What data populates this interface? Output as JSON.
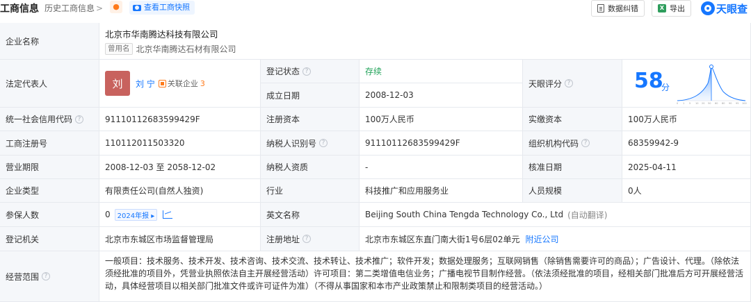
{
  "header": {
    "title": "工商信息",
    "history_link": "历史工商信息",
    "history_chevron": ">",
    "snapshot_button": "查看工商快照",
    "correction_button": "数据纠错",
    "export_button": "导出",
    "logo_text": "天眼查",
    "brand_color": "#1677ff"
  },
  "labels": {
    "company_name": "企业名称",
    "legal_rep": "法定代表人",
    "reg_status": "登记状态",
    "established": "成立日期",
    "tianyan_score": "天眼评分",
    "credit_code": "统一社会信用代码",
    "registered_capital": "注册资本",
    "paid_capital": "实缴资本",
    "business_reg_no": "工商注册号",
    "taxpayer_id": "纳税人识别号",
    "org_code": "组织机构代码",
    "business_term": "营业期限",
    "taxpayer_qualification": "纳税人资质",
    "approval_date": "核准日期",
    "company_type": "企业类型",
    "industry": "行业",
    "staff_size": "人员规模",
    "insured_count": "参保人数",
    "english_name": "英文名称",
    "registration_authority": "登记机关",
    "registered_address": "注册地址",
    "business_scope": "经营范围"
  },
  "company": {
    "name": "北京市华南腾达科技有限公司",
    "former_name_tag": "曾用名",
    "former_name": "北京华南腾达石材有限公司",
    "legal_rep_avatar": "刘",
    "legal_rep_name": "刘 宁",
    "related_label": "关联企业",
    "related_count": "3",
    "reg_status": "存续",
    "established": "2008-12-03",
    "score_value": "58",
    "score_unit": "分",
    "credit_code": "91110112683599429F",
    "registered_capital": "100万人民币",
    "paid_capital": "100万人民币",
    "business_reg_no": "110112011503320",
    "taxpayer_id": "91110112683599429F",
    "org_code": "68359942-9",
    "business_term": "2008-12-03 至 2058-12-02",
    "taxpayer_qualification": "-",
    "approval_date": "2025-04-11",
    "company_type": "有限责任公司(自然人独资)",
    "industry": "科技推广和应用服务业",
    "staff_size": "0人",
    "insured_count": "0",
    "report_tag": "2024年报",
    "english_name": "Beijing South China Tengda Technology Co., Ltd",
    "auto_translate": "(自动翻译)",
    "registration_authority": "北京市东城区市场监督管理局",
    "registered_address": "北京市东城区东直门南大街1号6层02单元",
    "nearby_link": "附近公司",
    "business_scope": "一般项目：技术服务、技术开发、技术咨询、技术交流、技术转让、技术推广；软件开发；数据处理服务；互联网销售（除销售需要许可的商品）；广告设计、代理。（除依法须经批准的项目外，凭营业执照依法自主开展经营活动）许可项目：第二类增值电信业务；广播电视节目制作经营。（依法须经批准的项目，经相关部门批准后方可开展经营活动，具体经营项目以相关部门批准文件或许可证件为准）（不得从事国家和本市产业政策禁止和限制类项目的经营活动。）"
  }
}
